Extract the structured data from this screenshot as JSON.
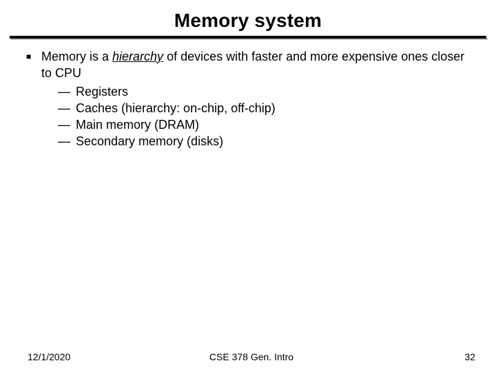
{
  "title": "Memory system",
  "bullet": {
    "pre": "Memory is a ",
    "emph": "hierarchy",
    "post": " of devices with faster and more expensive ones closer to CPU"
  },
  "sub": [
    "Registers",
    "Caches (hierarchy: on-chip, off-chip)",
    "Main memory (DRAM)",
    "Secondary memory (disks)"
  ],
  "footer": {
    "date": "12/1/2020",
    "center": "CSE 378 Gen. Intro",
    "page": "32"
  }
}
